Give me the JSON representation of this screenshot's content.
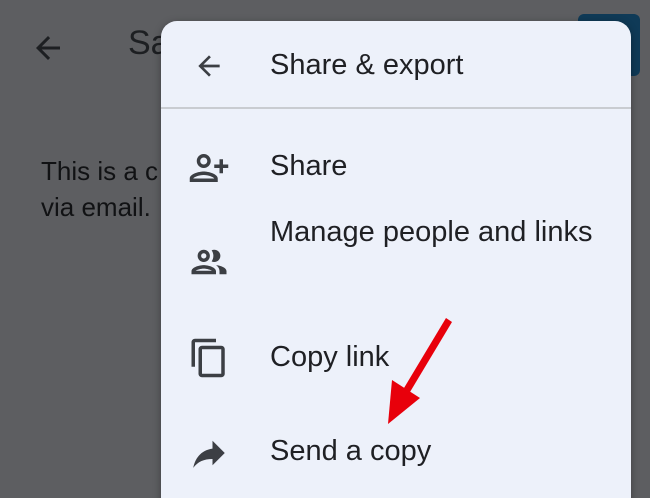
{
  "background_page": {
    "title_fragment": "Sa",
    "body_lines": [
      "This is a c",
      "via email."
    ]
  },
  "menu": {
    "title": "Share & export",
    "items": [
      {
        "label": "Share",
        "icon": "person-add-icon"
      },
      {
        "label": "Manage people and links",
        "icon": "people-icon"
      },
      {
        "label": "Copy link",
        "icon": "copy-icon"
      },
      {
        "label": "Send a copy",
        "icon": "forward-arrow-icon"
      }
    ]
  },
  "colors": {
    "scrim": "#5d5e61",
    "menu_background": "#edf1fa",
    "text": "#1f2024",
    "annotation_arrow": "#e8000b"
  }
}
